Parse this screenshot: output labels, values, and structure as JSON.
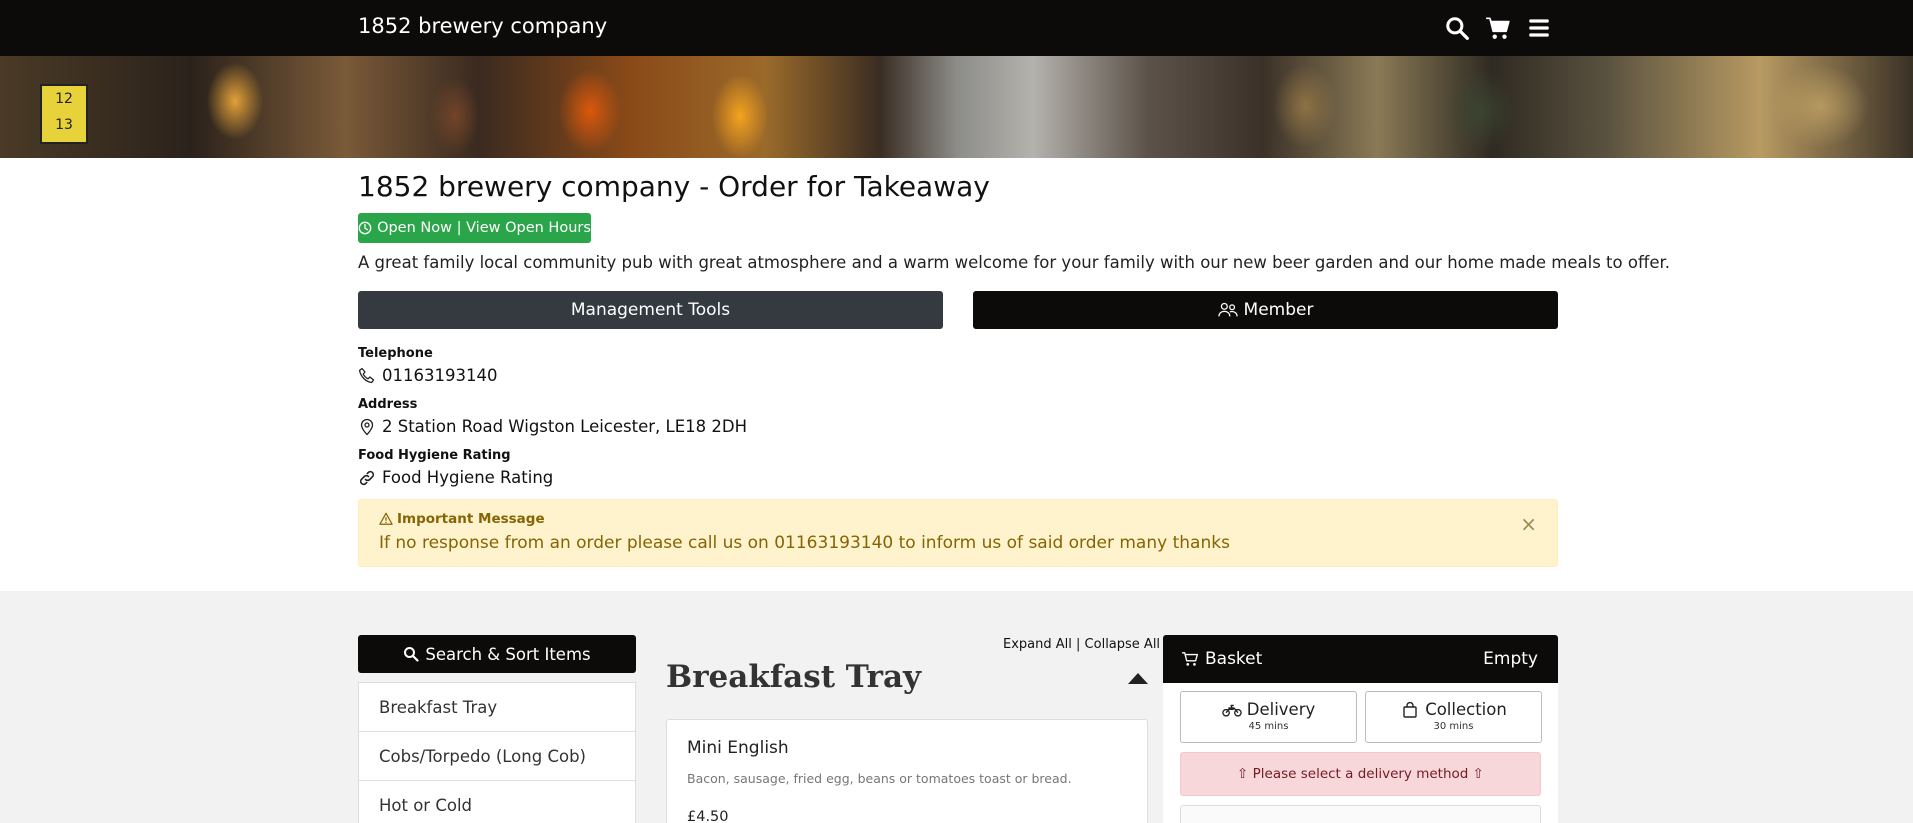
{
  "navbar": {
    "brand": "1852 brewery company",
    "icons": [
      "search-icon",
      "cart-icon",
      "menu-icon"
    ]
  },
  "hero": {
    "sign_text": [
      "12",
      "13"
    ]
  },
  "header": {
    "title": "1852 brewery company - Order for Takeaway",
    "open_label": "Open Now | View Open Hours",
    "description": "A great family local community pub with great atmosphere and a warm welcome for your family with our new beer garden and our home made meals to offer.",
    "management_label": "Management Tools",
    "member_label": "Member"
  },
  "contact": {
    "telephone_label": "Telephone",
    "telephone": "01163193140",
    "address_label": "Address",
    "address": "2 Station Road Wigston Leicester, LE18 2DH",
    "hygiene_label": "Food Hygiene Rating",
    "hygiene_link": "Food Hygiene Rating"
  },
  "alert": {
    "title": "Important Message",
    "text": "If no response from an order please call us on 01163193140 to inform us of said order many thanks",
    "close": "×"
  },
  "menu": {
    "search_sort_label": "Search & Sort Items",
    "categories": [
      "Breakfast Tray",
      "Cobs/Torpedo (Long Cob)",
      "Hot or Cold"
    ],
    "expand_all": "Expand All",
    "separator": "|",
    "collapse_all": "Collapse All",
    "section_title": "Breakfast Tray",
    "items": [
      {
        "name": "Mini English",
        "description": "Bacon, sausage, fried egg, beans or tomatoes toast or bread.",
        "price": "£4.50"
      }
    ]
  },
  "basket": {
    "title": "Basket",
    "status": "Empty",
    "delivery_label": "Delivery",
    "delivery_time": "45 mins",
    "collection_label": "Collection",
    "collection_time": "30 mins",
    "warning": "⇧ Please select a delivery method ⇧"
  },
  "colors": {
    "navbar": "#0d0b0a",
    "open_green": "#2ba54a",
    "management": "#343a40",
    "alert_bg": "#fff3cd",
    "alert_text": "#856404",
    "warning_bg": "#f8d7da",
    "warning_text": "#721c24"
  }
}
